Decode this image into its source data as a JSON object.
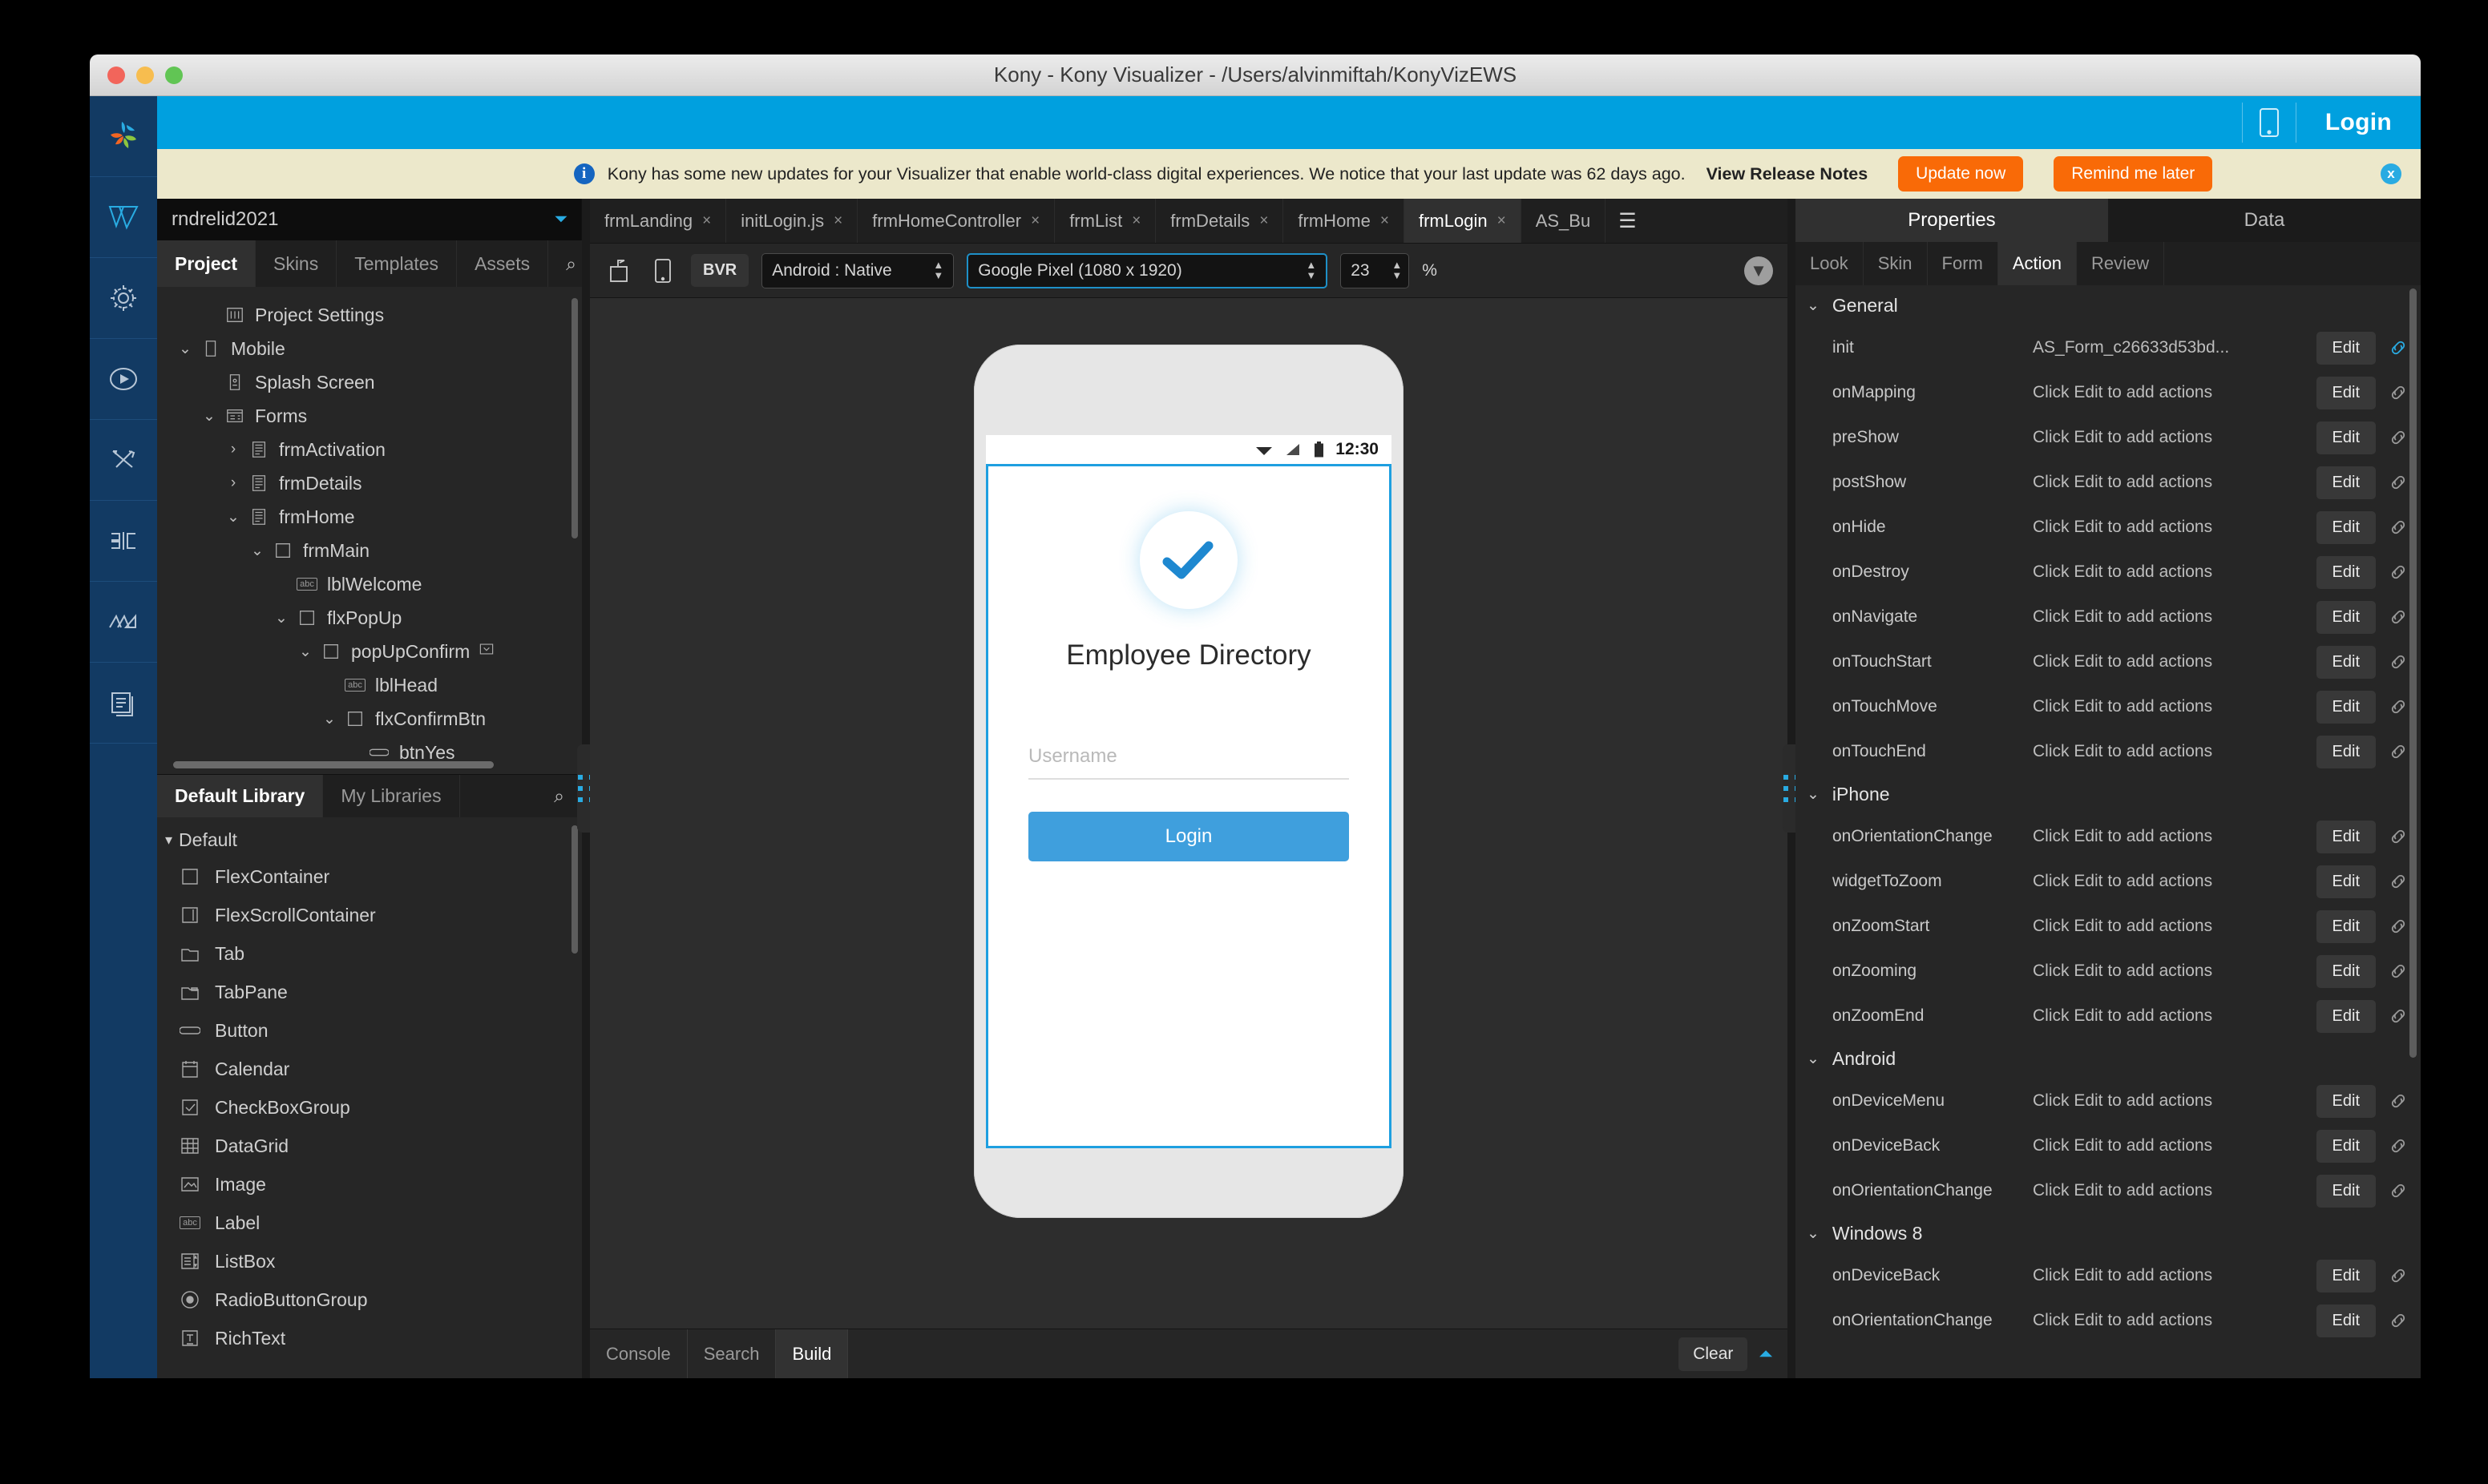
{
  "window": {
    "title": "Kony - Kony Visualizer - /Users/alvinmiftah/KonyVizEWS"
  },
  "topbar": {
    "login_label": "Login",
    "device_icon": "mobile-device-icon"
  },
  "notification": {
    "icon": "info-icon",
    "message": "Kony has some new updates for your Visualizer that enable world-class digital experiences. We notice that your last update was 62 days ago.",
    "link_label": "View Release Notes",
    "primary_button": "Update now",
    "secondary_button": "Remind me later",
    "close_label": "x",
    "accent_color": "#f96a07",
    "background_color": "#ece8cb"
  },
  "rail": {
    "items": [
      {
        "name": "kony-logo-icon"
      },
      {
        "name": "visualizer-icon"
      },
      {
        "name": "gear-icon"
      },
      {
        "name": "play-icon"
      },
      {
        "name": "tools-icon"
      },
      {
        "name": "layout-icon"
      },
      {
        "name": "charts-icon"
      },
      {
        "name": "documents-icon"
      }
    ]
  },
  "left_panel": {
    "project_name": "rndrelid2021",
    "tabs": [
      {
        "label": "Project",
        "active": true
      },
      {
        "label": "Skins",
        "active": false
      },
      {
        "label": "Templates",
        "active": false
      },
      {
        "label": "Assets",
        "active": false
      }
    ],
    "search_icon": "search-icon",
    "menu_icon": "hamburger-menu-icon",
    "tree": [
      {
        "label": "Project Settings",
        "indent": 1,
        "twisty": "",
        "icon": "settings-sliders-icon"
      },
      {
        "label": "Mobile",
        "indent": 0,
        "twisty": "v",
        "icon": "phone-outline-icon"
      },
      {
        "label": "Splash Screen",
        "indent": 1,
        "twisty": "",
        "icon": "splash-screen-icon"
      },
      {
        "label": "Forms",
        "indent": 1,
        "twisty": "v",
        "icon": "forms-icon"
      },
      {
        "label": "frmActivation",
        "indent": 2,
        "twisty": ">",
        "icon": "form-icon"
      },
      {
        "label": "frmDetails",
        "indent": 2,
        "twisty": ">",
        "icon": "form-icon"
      },
      {
        "label": "frmHome",
        "indent": 2,
        "twisty": "v",
        "icon": "form-icon"
      },
      {
        "label": "frmMain",
        "indent": 3,
        "twisty": "v",
        "icon": "flex-container-icon"
      },
      {
        "label": "lblWelcome",
        "indent": 4,
        "twisty": "",
        "icon": "label-abc-icon"
      },
      {
        "label": "flxPopUp",
        "indent": 4,
        "twisty": "v",
        "icon": "flex-container-icon"
      },
      {
        "label": "popUpConfirm",
        "indent": 5,
        "twisty": "v",
        "icon": "flex-container-icon",
        "suffix": "dropdown-box-icon"
      },
      {
        "label": "lblHead",
        "indent": 6,
        "twisty": "",
        "icon": "label-abc-icon"
      },
      {
        "label": "flxConfirmBtn",
        "indent": 6,
        "twisty": "v",
        "icon": "flex-container-icon"
      },
      {
        "label": "btnYes",
        "indent": 7,
        "twisty": "",
        "icon": "button-icon"
      }
    ],
    "library_tabs": [
      {
        "label": "Default Library",
        "active": true
      },
      {
        "label": "My Libraries",
        "active": false
      }
    ],
    "library_group": "Default",
    "library_items": [
      {
        "label": "FlexContainer",
        "icon": "flex-container-icon"
      },
      {
        "label": "FlexScrollContainer",
        "icon": "flex-scroll-container-icon"
      },
      {
        "label": "Tab",
        "icon": "tab-icon"
      },
      {
        "label": "TabPane",
        "icon": "tab-pane-icon"
      },
      {
        "label": "Button",
        "icon": "button-icon"
      },
      {
        "label": "Calendar",
        "icon": "calendar-icon"
      },
      {
        "label": "CheckBoxGroup",
        "icon": "checkbox-icon"
      },
      {
        "label": "DataGrid",
        "icon": "datagrid-icon"
      },
      {
        "label": "Image",
        "icon": "image-icon"
      },
      {
        "label": "Label",
        "icon": "label-abc-icon"
      },
      {
        "label": "ListBox",
        "icon": "listbox-icon"
      },
      {
        "label": "RadioButtonGroup",
        "icon": "radio-button-icon"
      },
      {
        "label": "RichText",
        "icon": "richtext-icon"
      }
    ]
  },
  "editor": {
    "tabs": [
      {
        "label": "frmLanding",
        "active": false
      },
      {
        "label": "initLogin.js",
        "active": false
      },
      {
        "label": "frmHomeController",
        "active": false
      },
      {
        "label": "frmList",
        "active": false
      },
      {
        "label": "frmDetails",
        "active": false
      },
      {
        "label": "frmHome",
        "active": false
      },
      {
        "label": "frmLogin",
        "active": true
      },
      {
        "label": "AS_Bu",
        "active": false,
        "no_close": true
      }
    ],
    "toolbar": {
      "export_icon": "export-form-icon",
      "preview_icon": "device-preview-icon",
      "bvr_label": "BVR",
      "platform_value": "Android : Native",
      "device_value": "Google Pixel (1080 x 1920)",
      "zoom_value": "23",
      "percent_label": "%",
      "collapse_icon": "chevron-down-circle-icon"
    }
  },
  "canvas": {
    "status_time": "12:30",
    "status_icons": [
      "wifi-icon",
      "signal-icon",
      "battery-icon"
    ],
    "check_icon": "check-mark-icon",
    "app_title": "Employee Directory",
    "username_placeholder": "Username",
    "login_button": "Login",
    "accent_color": "#3f9fdd",
    "selection_color": "#1e9fe0"
  },
  "console": {
    "tabs": [
      {
        "label": "Console",
        "active": false
      },
      {
        "label": "Search",
        "active": false
      },
      {
        "label": "Build",
        "active": true
      }
    ],
    "clear_label": "Clear",
    "collapse_icon": "chevron-up-icon"
  },
  "right_panel": {
    "top_tabs": [
      {
        "label": "Properties",
        "active": true
      },
      {
        "label": "Data",
        "active": false
      }
    ],
    "sub_tabs": [
      {
        "label": "Look",
        "active": false
      },
      {
        "label": "Skin",
        "active": false
      },
      {
        "label": "Form",
        "active": false
      },
      {
        "label": "Action",
        "active": true
      },
      {
        "label": "Review",
        "active": false
      }
    ],
    "edit_label": "Edit",
    "link_icon": "link-chain-icon",
    "sections": [
      {
        "title": "General",
        "rows": [
          {
            "name": "init",
            "value": "AS_Form_c26633d53bd...",
            "linked": true
          },
          {
            "name": "onMapping",
            "value": "Click Edit to add actions",
            "linked": false
          },
          {
            "name": "preShow",
            "value": "Click Edit to add actions",
            "linked": false
          },
          {
            "name": "postShow",
            "value": "Click Edit to add actions",
            "linked": false
          },
          {
            "name": "onHide",
            "value": "Click Edit to add actions",
            "linked": false
          },
          {
            "name": "onDestroy",
            "value": "Click Edit to add actions",
            "linked": false
          },
          {
            "name": "onNavigate",
            "value": "Click Edit to add actions",
            "linked": false
          },
          {
            "name": "onTouchStart",
            "value": "Click Edit to add actions",
            "linked": false
          },
          {
            "name": "onTouchMove",
            "value": "Click Edit to add actions",
            "linked": false
          },
          {
            "name": "onTouchEnd",
            "value": "Click Edit to add actions",
            "linked": false
          }
        ]
      },
      {
        "title": "iPhone",
        "rows": [
          {
            "name": "onOrientationChange",
            "value": "Click Edit to add actions",
            "linked": false
          },
          {
            "name": "widgetToZoom",
            "value": "Click Edit to add actions",
            "linked": false
          },
          {
            "name": "onZoomStart",
            "value": "Click Edit to add actions",
            "linked": false
          },
          {
            "name": "onZooming",
            "value": "Click Edit to add actions",
            "linked": false
          },
          {
            "name": "onZoomEnd",
            "value": "Click Edit to add actions",
            "linked": false
          }
        ]
      },
      {
        "title": "Android",
        "rows": [
          {
            "name": "onDeviceMenu",
            "value": "Click Edit to add actions",
            "linked": false
          },
          {
            "name": "onDeviceBack",
            "value": "Click Edit to add actions",
            "linked": false
          },
          {
            "name": "onOrientationChange",
            "value": "Click Edit to add actions",
            "linked": false
          }
        ]
      },
      {
        "title": "Windows 8",
        "rows": [
          {
            "name": "onDeviceBack",
            "value": "Click Edit to add actions",
            "linked": false
          },
          {
            "name": "onOrientationChange",
            "value": "Click Edit to add actions",
            "linked": false
          }
        ]
      }
    ]
  }
}
